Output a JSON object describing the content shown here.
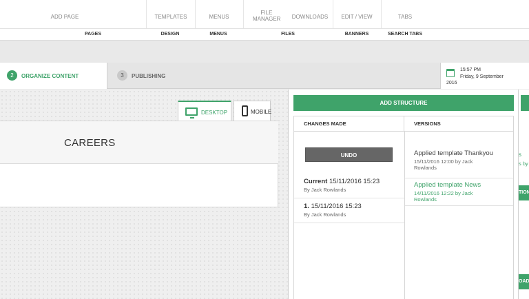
{
  "ribbon": {
    "items": [
      {
        "label": "ADD PAGE",
        "icon": "page-icon"
      },
      {
        "label": "TEMPLATES",
        "icon": "templates-icon"
      },
      {
        "label": "MENUS",
        "icon": "menus-icon"
      },
      {
        "label": "FILE MANAGER",
        "icon": "folder-icon"
      },
      {
        "label": "DOWNLOADS",
        "icon": "download-icon"
      },
      {
        "label": "EDIT / VIEW",
        "icon": "banner-icon"
      },
      {
        "label": "TABS",
        "icon": "tabs-icon"
      }
    ],
    "groups": [
      "PAGES",
      "DESIGN",
      "MENUS",
      "FILES",
      "BANNERS",
      "SEARCH TABS"
    ]
  },
  "steps": [
    {
      "number": "2",
      "label": "ORGANIZE CONTENT",
      "active": true
    },
    {
      "number": "3",
      "label": "PUBLISHING",
      "active": false
    }
  ],
  "datetime": {
    "time": "15:57 PM",
    "date": "Friday, 9 September",
    "year": "2016"
  },
  "view_tabs": {
    "desktop": "DESKTOP",
    "mobile": "MOBILE"
  },
  "page": {
    "title": "CAREERS"
  },
  "panel": {
    "add_structure": "ADD STRUCTURE",
    "changes_header": "CHANGES MADE",
    "versions_header": "VERSIONS",
    "undo": "UNDO",
    "changes": [
      {
        "prefix": "Current",
        "date": "15/11/2016 15:23",
        "by": "By Jack Rowlands"
      },
      {
        "prefix": "1.",
        "date": "15/11/2016 15:23",
        "by": "By Jack Rowlands"
      }
    ],
    "versions": [
      {
        "title": "Applied template Thankyou",
        "meta": "15/11/2016 12:00 by Jack Rowlands",
        "active": false
      },
      {
        "title": "Applied template News",
        "meta": "14/11/2016 12:22 by Jack Rowlands",
        "active": true
      }
    ]
  },
  "far_panel": {
    "text1": "s",
    "text2": "s by",
    "button1": "TION",
    "button2": "OAD"
  },
  "colors": {
    "accent": "#3fa36a",
    "undo": "#666666"
  }
}
